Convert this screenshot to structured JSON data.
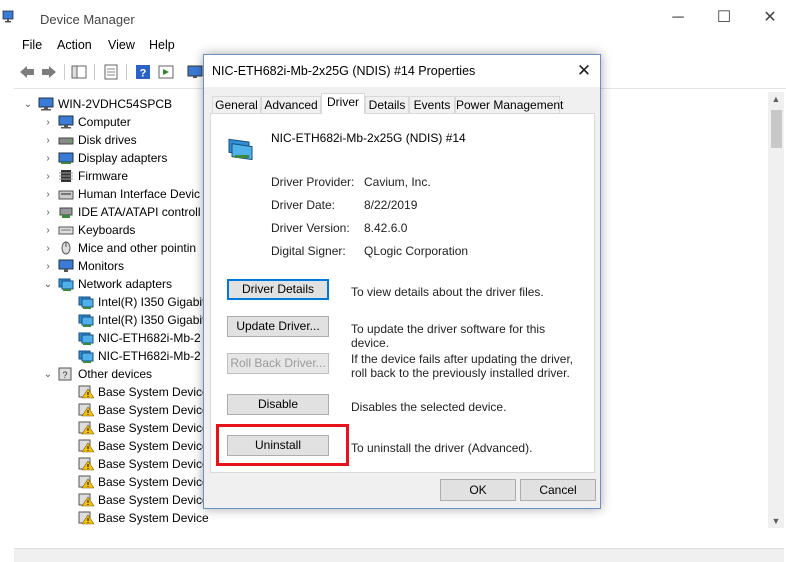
{
  "window": {
    "title": "Device Manager",
    "minimize_glyph": "─",
    "maximize_glyph": "☐",
    "close_glyph": "✕"
  },
  "menu": [
    "File",
    "Action",
    "View",
    "Help"
  ],
  "toolbar_icons": [
    "back-arrow-icon",
    "forward-arrow-icon",
    "show-hide-tree-icon",
    "properties-icon",
    "help-icon",
    "action-icon",
    "monitor-icon"
  ],
  "tree": {
    "root": "WIN-2VDHC54SPCB",
    "items": [
      {
        "label": "Computer",
        "level": 1,
        "expander": "›",
        "icon": "computer-icon"
      },
      {
        "label": "Disk drives",
        "level": 1,
        "expander": "›",
        "icon": "disk-drive-icon"
      },
      {
        "label": "Display adapters",
        "level": 1,
        "expander": "›",
        "icon": "display-adapter-icon"
      },
      {
        "label": "Firmware",
        "level": 1,
        "expander": "›",
        "icon": "firmware-icon"
      },
      {
        "label": "Human Interface Devic",
        "level": 1,
        "expander": "›",
        "icon": "hid-icon"
      },
      {
        "label": "IDE ATA/ATAPI controll",
        "level": 1,
        "expander": "›",
        "icon": "ide-controller-icon"
      },
      {
        "label": "Keyboards",
        "level": 1,
        "expander": "›",
        "icon": "keyboard-icon"
      },
      {
        "label": "Mice and other pointin",
        "level": 1,
        "expander": "›",
        "icon": "mouse-icon"
      },
      {
        "label": "Monitors",
        "level": 1,
        "expander": "›",
        "icon": "monitor-icon"
      },
      {
        "label": "Network adapters",
        "level": 1,
        "expander": "⌄",
        "icon": "network-adapter-icon"
      },
      {
        "label": "Intel(R) I350 Gigabit",
        "level": 2,
        "expander": "",
        "icon": "network-adapter-icon"
      },
      {
        "label": "Intel(R) I350 Gigabit",
        "level": 2,
        "expander": "",
        "icon": "network-adapter-icon"
      },
      {
        "label": "NIC-ETH682i-Mb-2",
        "level": 2,
        "expander": "",
        "icon": "network-adapter-icon"
      },
      {
        "label": "NIC-ETH682i-Mb-2",
        "level": 2,
        "expander": "",
        "icon": "network-adapter-icon"
      },
      {
        "label": "Other devices",
        "level": 1,
        "expander": "⌄",
        "icon": "unknown-device-icon"
      },
      {
        "label": "Base System Device",
        "level": 2,
        "expander": "",
        "icon": "warning-device-icon"
      },
      {
        "label": "Base System Device",
        "level": 2,
        "expander": "",
        "icon": "warning-device-icon"
      },
      {
        "label": "Base System Device",
        "level": 2,
        "expander": "",
        "icon": "warning-device-icon"
      },
      {
        "label": "Base System Device",
        "level": 2,
        "expander": "",
        "icon": "warning-device-icon"
      },
      {
        "label": "Base System Device",
        "level": 2,
        "expander": "",
        "icon": "warning-device-icon"
      },
      {
        "label": "Base System Device",
        "level": 2,
        "expander": "",
        "icon": "warning-device-icon"
      },
      {
        "label": "Base System Device",
        "level": 2,
        "expander": "",
        "icon": "warning-device-icon"
      },
      {
        "label": "Base System Device",
        "level": 2,
        "expander": "",
        "icon": "warning-device-icon"
      }
    ]
  },
  "dialog": {
    "title": "NIC-ETH682i-Mb-2x25G (NDIS) #14 Properties",
    "close_glyph": "✕",
    "tabs": [
      "General",
      "Advanced",
      "Driver",
      "Details",
      "Events",
      "Power Management"
    ],
    "active_tab": "Driver",
    "device_name": "NIC-ETH682i-Mb-2x25G (NDIS) #14",
    "properties": [
      {
        "label": "Driver Provider:",
        "value": "Cavium, Inc."
      },
      {
        "label": "Driver Date:",
        "value": "8/22/2019"
      },
      {
        "label": "Driver Version:",
        "value": "8.42.6.0"
      },
      {
        "label": "Digital Signer:",
        "value": "QLogic Corporation"
      }
    ],
    "actions": [
      {
        "label": "Driver Details",
        "desc": "To view details about the driver files.",
        "state": "focused"
      },
      {
        "label": "Update Driver...",
        "desc": "To update the driver software for this device.",
        "state": "normal"
      },
      {
        "label": "Roll Back Driver...",
        "desc": "If the device fails after updating the driver, roll back to the previously installed driver.",
        "state": "disabled"
      },
      {
        "label": "Disable",
        "desc": "Disables the selected device.",
        "state": "normal"
      },
      {
        "label": "Uninstall",
        "desc": "To uninstall the driver (Advanced).",
        "state": "normal"
      }
    ],
    "ok_label": "OK",
    "cancel_label": "Cancel",
    "highlight_color": "#e8121b"
  },
  "colors": {
    "accent": "#0078d7",
    "dialog_border": "#6c8fc8"
  }
}
